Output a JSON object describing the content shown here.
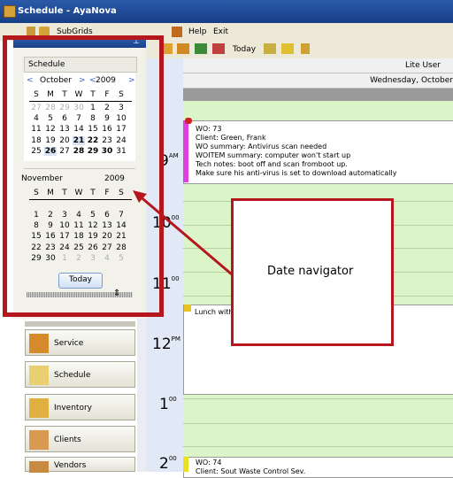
{
  "window": {
    "title": "Schedule - AyaNova"
  },
  "left_toolbar": {
    "subgrids_label": "SubGrids"
  },
  "menu": {
    "help": "Help",
    "exit": "Exit"
  },
  "toolbar": {
    "today_label": "Today"
  },
  "panel": {
    "schedule_label": "Schedule",
    "today_button": "Today"
  },
  "calendar1": {
    "month": "October",
    "year": "2009",
    "prev": "<",
    "next": ">",
    "prev_year": "<",
    "next_year": ">",
    "weekdays": [
      "S",
      "M",
      "T",
      "W",
      "T",
      "F",
      "S"
    ],
    "rows": [
      [
        "27",
        "28",
        "29",
        "30",
        "1",
        "2",
        "3"
      ],
      [
        "4",
        "5",
        "6",
        "7",
        "8",
        "9",
        "10"
      ],
      [
        "11",
        "12",
        "13",
        "14",
        "15",
        "16",
        "17"
      ],
      [
        "18",
        "19",
        "20",
        "21",
        "22",
        "23",
        "24"
      ],
      [
        "25",
        "26",
        "27",
        "28",
        "29",
        "30",
        "31"
      ]
    ]
  },
  "calendar2": {
    "month": "November",
    "year": "2009",
    "weekdays": [
      "S",
      "M",
      "T",
      "W",
      "T",
      "F",
      "S"
    ],
    "rows": [
      [
        "1",
        "2",
        "3",
        "4",
        "5",
        "6",
        "7"
      ],
      [
        "8",
        "9",
        "10",
        "11",
        "12",
        "13",
        "14"
      ],
      [
        "15",
        "16",
        "17",
        "18",
        "19",
        "20",
        "21"
      ],
      [
        "22",
        "23",
        "24",
        "25",
        "26",
        "27",
        "28"
      ],
      [
        "29",
        "30",
        "1",
        "2",
        "3",
        "4",
        "5"
      ]
    ]
  },
  "nav_buttons": [
    {
      "label": "Service"
    },
    {
      "label": "Schedule"
    },
    {
      "label": "Inventory"
    },
    {
      "label": "Clients"
    },
    {
      "label": "Vendors"
    }
  ],
  "schedule": {
    "user": "Lite User",
    "date": "Wednesday, October"
  },
  "hours": [
    {
      "h": "9",
      "s": "AM"
    },
    {
      "h": "10",
      "s": "00"
    },
    {
      "h": "11",
      "s": "00"
    },
    {
      "h": "12",
      "s": "PM"
    },
    {
      "h": "1",
      "s": "00"
    },
    {
      "h": "2",
      "s": "00"
    }
  ],
  "appt1": {
    "lines": [
      "WO: 73",
      "Client:  Green, Frank",
      "WO summary: Antivirus scan needed",
      "WOITEM summary: computer won't start up",
      "Tech notes: boot off and scan fromboot up.",
      "Make sure his anti-virus is set to download automatically"
    ]
  },
  "appt2": {
    "text": "Lunch with"
  },
  "appt3": {
    "line1": "WO: 74",
    "line2": "Client: Sout Waste Control Sev."
  },
  "callout": {
    "text": "Date navigator"
  },
  "colors": {
    "title_bar": "#1c4794",
    "red": "#b5171d",
    "green_slots": "#dcf5c8",
    "appt_stripe": "#e040e0"
  }
}
